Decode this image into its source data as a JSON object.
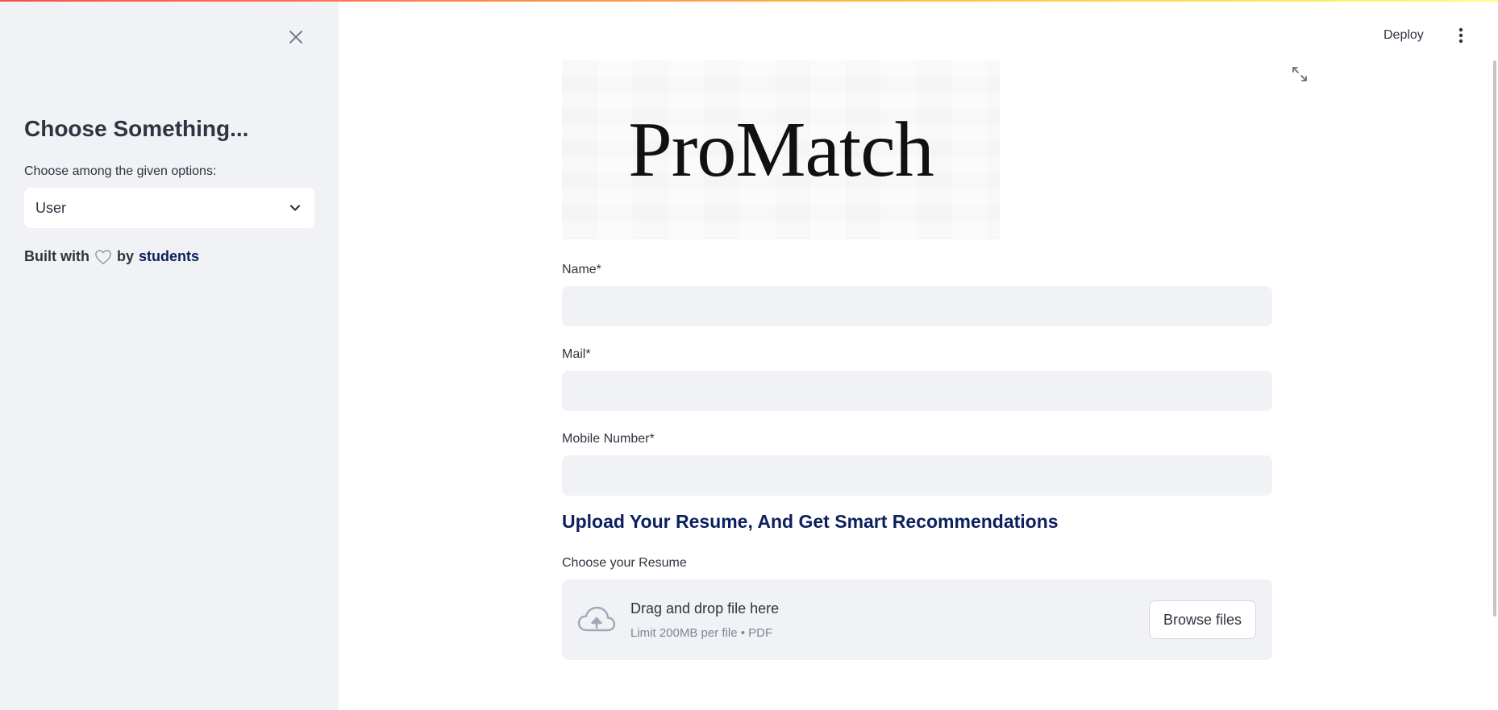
{
  "sidebar": {
    "title": "Choose Something...",
    "select_label": "Choose among the given options:",
    "select_value": "User",
    "built_with_prefix": "Built with",
    "built_with_by": "by",
    "built_with_link": "students"
  },
  "header": {
    "deploy_label": "Deploy"
  },
  "logo": {
    "text": "ProMatch"
  },
  "form": {
    "name_label": "Name*",
    "name_value": "",
    "mail_label": "Mail*",
    "mail_value": "",
    "mobile_label": "Mobile Number*",
    "mobile_value": ""
  },
  "upload": {
    "heading": "Upload Your Resume, And Get Smart Recommendations",
    "label": "Choose your Resume",
    "drop_title": "Drag and drop file here",
    "drop_limit": "Limit 200MB per file • PDF",
    "browse_label": "Browse files"
  },
  "colors": {
    "accent": "#0c1f5e",
    "sidebar_bg": "#f0f2f6",
    "input_bg": "#f0f2f6"
  }
}
